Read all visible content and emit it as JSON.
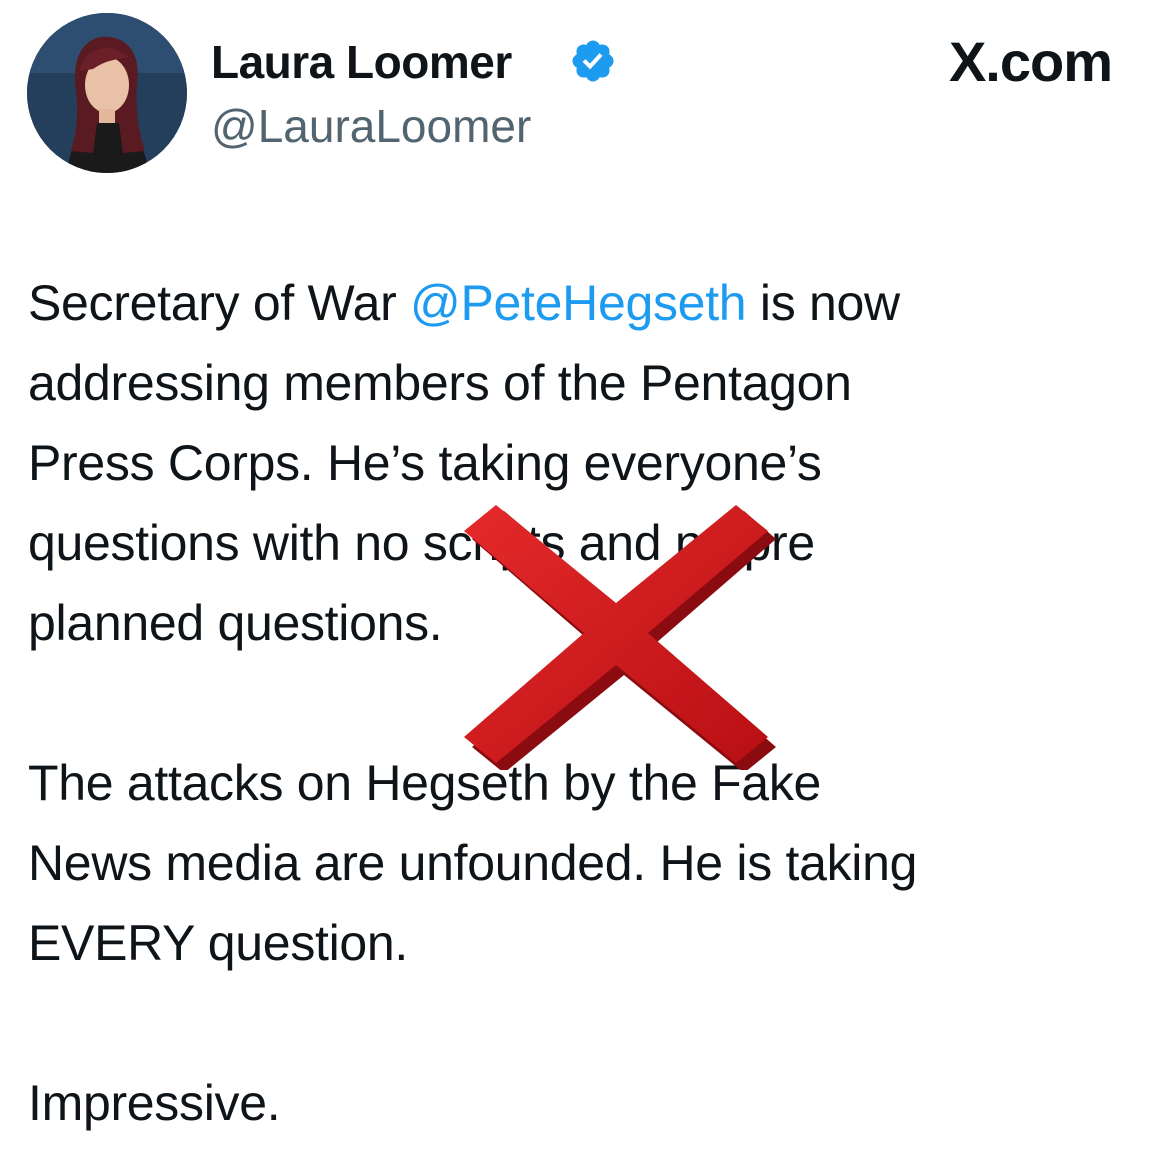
{
  "header": {
    "display_name": "Laura Loomer",
    "handle": "@LauraLoomer",
    "site_mark": "X.com",
    "avatar_icon": "profile-photo",
    "verified_icon": "verified-badge-icon",
    "verified_color": "#1d9bf0"
  },
  "tweet": {
    "line1_before": "Secretary of War ",
    "line1_mention": "@PeteHegseth",
    "line1_after": " is now",
    "line2": "addressing members of the Pentagon",
    "line3": "Press Corps. He’s taking everyone’s",
    "line4": "questions with no scripts and no pre",
    "line5": "planned questions.",
    "line6": "The attacks on Hegseth by the Fake",
    "line7": "News media are unfounded. He is taking",
    "line8": "EVERY question.",
    "line9": "Impressive.",
    "mention_color": "#1d9bf0"
  },
  "overlay": {
    "icon": "red-x-icon",
    "color": "#d0161c"
  }
}
